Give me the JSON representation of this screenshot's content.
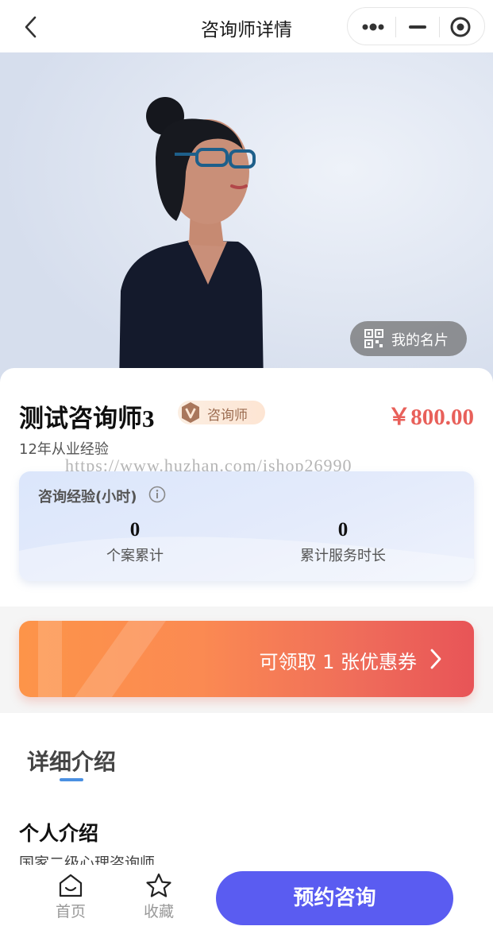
{
  "nav": {
    "title": "咨询师详情",
    "back_icon": "chevron-left-icon",
    "more_icon": "more-dots-icon",
    "minimize_icon": "minimize-icon",
    "close_icon": "target-circle-icon"
  },
  "hero": {
    "card_badge_label": "我的名片",
    "card_badge_icon": "qrcode-icon"
  },
  "counselor": {
    "name": "测试咨询师3",
    "role_badge": "咨询师",
    "role_badge_icon": "v-badge-icon",
    "price": "￥800.00",
    "experience": "12年从业经验"
  },
  "watermark": "https://www.huzhan.com/ishop26990",
  "stats": {
    "title": "咨询经验(小时)",
    "info_icon": "info-circle-icon",
    "items": [
      {
        "value": "0",
        "label": "个案累计"
      },
      {
        "value": "0",
        "label": "累计服务时长"
      }
    ]
  },
  "coupon": {
    "text": "可领取 1 张优惠券",
    "chevron_icon": "chevron-right-icon"
  },
  "details": {
    "tab_label": "详细介绍",
    "section_title": "个人介绍",
    "section_body": "国家二级心理咨询师"
  },
  "bottom": {
    "home_label": "首页",
    "home_icon": "home-icon",
    "fav_label": "收藏",
    "fav_icon": "star-icon",
    "book_label": "预约咨询"
  },
  "colors": {
    "price": "#e8605a",
    "book_button": "#5a5cf1",
    "coupon_start": "#fd9449",
    "coupon_end": "#e85457",
    "tab_underline": "#4a90e2"
  }
}
